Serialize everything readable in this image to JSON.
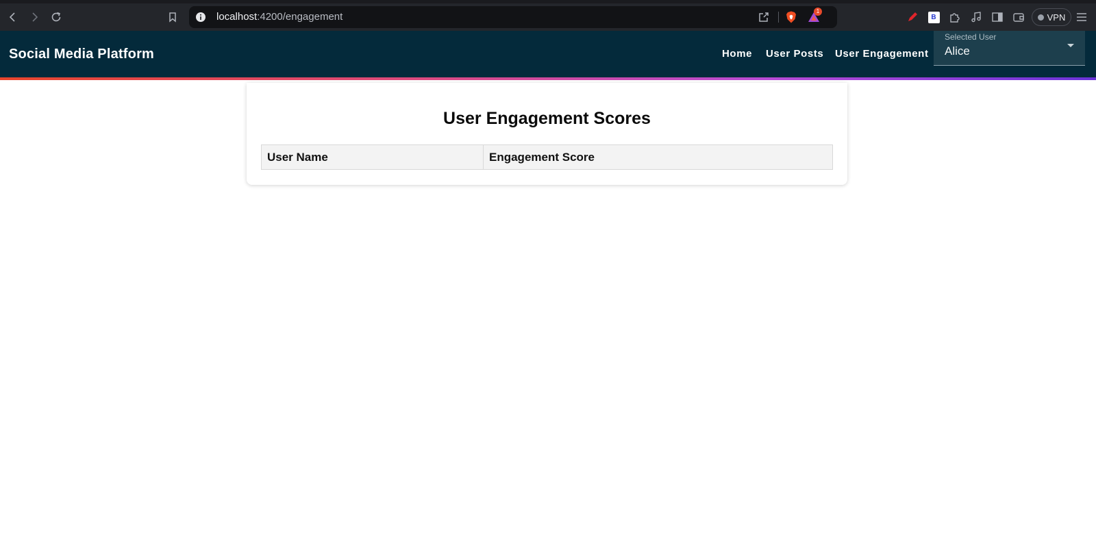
{
  "browser": {
    "url_host": "localhost",
    "url_path": ":4200/engagement",
    "notification_count": "1",
    "vpn_label": "VPN"
  },
  "app": {
    "title": "Social Media Platform",
    "nav": {
      "home": "Home",
      "user_posts": "User Posts",
      "user_engagement": "User Engagement"
    },
    "user_select": {
      "label": "Selected User",
      "value": "Alice"
    }
  },
  "engagement": {
    "title": "User Engagement Scores",
    "columns": [
      "User Name",
      "Engagement Score"
    ]
  },
  "colors": {
    "header_bg": "#042a3b",
    "accent_gradient_start": "#e8452c",
    "accent_gradient_end": "#6a33d9"
  }
}
